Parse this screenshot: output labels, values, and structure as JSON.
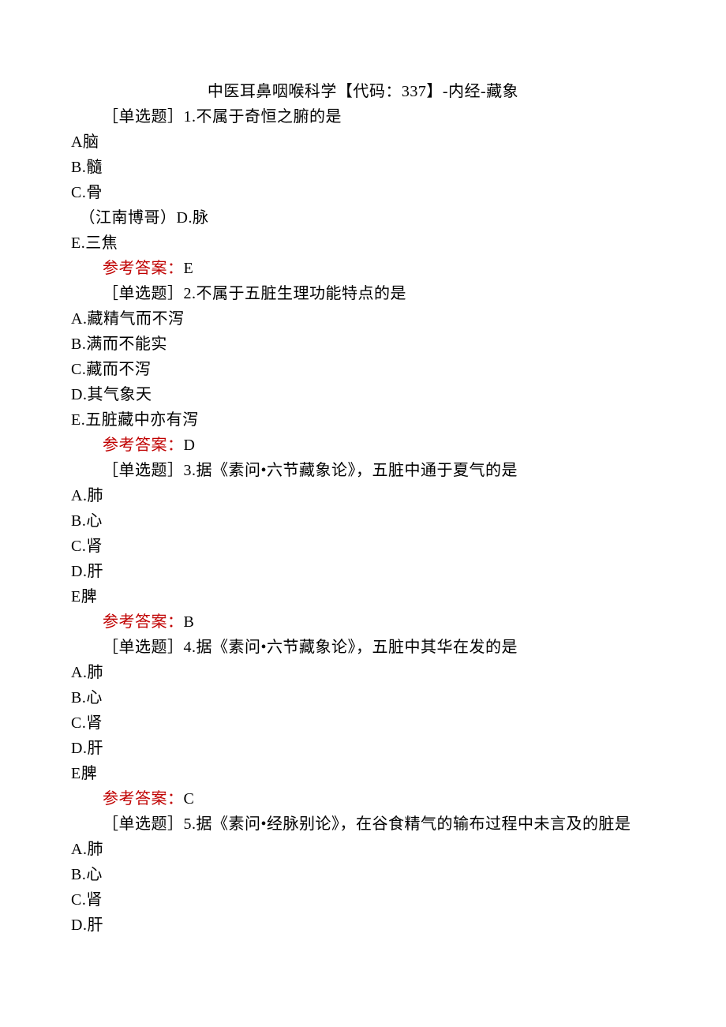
{
  "title": "中医耳鼻咽喉科学【代码：337】-内经-藏象",
  "questions": [
    {
      "stem": "［单选题］1.不属于奇恒之腑的是",
      "options": [
        "A脑",
        "B.髓",
        "C.骨",
        "　（江南博哥）D.脉",
        "E.三焦"
      ],
      "answer_label": "参考答案：",
      "answer_value": "E"
    },
    {
      "stem": "［单选题］2.不属于五脏生理功能特点的是",
      "options": [
        "A.藏精气而不泻",
        "B.满而不能实",
        "C.藏而不泻",
        "D.其气象天",
        "E.五脏藏中亦有泻"
      ],
      "answer_label": "参考答案：",
      "answer_value": "D"
    },
    {
      "stem": "［单选题］3.据《素问•六节藏象论》，五脏中通于夏气的是",
      "options": [
        "A.肺",
        "B.心",
        "C.肾",
        "D.肝",
        "E脾"
      ],
      "answer_label": "参考答案：",
      "answer_value": "B"
    },
    {
      "stem": "［单选题］4.据《素问•六节藏象论》，五脏中其华在发的是",
      "options": [
        "A.肺",
        "B.心",
        "C.肾",
        "D.肝",
        "E脾"
      ],
      "answer_label": "参考答案：",
      "answer_value": "C"
    },
    {
      "stem": "［单选题］5.据《素问•经脉别论》，在谷食精气的输布过程中未言及的脏是",
      "options": [
        "A.肺",
        "B.心",
        "C.肾",
        "D.肝"
      ],
      "answer_label": "",
      "answer_value": ""
    }
  ]
}
